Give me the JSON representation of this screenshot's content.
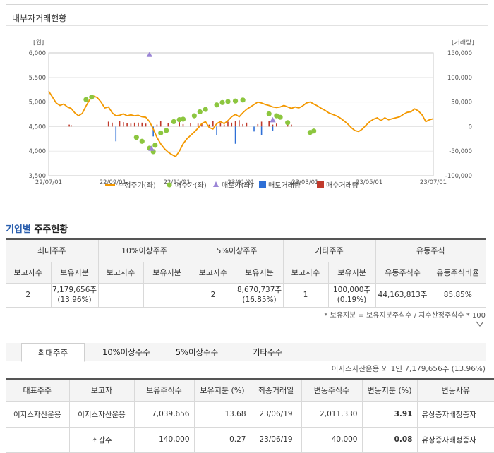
{
  "panel_title": "내부자거래현황",
  "chart_data": {
    "type": "line",
    "title": "",
    "y_left_unit": "[원]",
    "y_right_unit": "[거래량]",
    "y_left_ticks": [
      "6,000",
      "5,500",
      "5,000",
      "4,500",
      "4,000",
      "3,500"
    ],
    "y_right_ticks": [
      "150,000",
      "100,000",
      "50,000",
      "0",
      "-50,000",
      "-100,000"
    ],
    "ylim_left": [
      3500,
      6000
    ],
    "ylim_right": [
      -100000,
      150000
    ],
    "x_ticks": [
      "22/07/01",
      "22/09/01",
      "22/11/01",
      "23/01/01",
      "23/03/01",
      "23/05/01",
      "23/07/01"
    ],
    "legend": [
      "수정주가(좌)",
      "매수가(좌)",
      "매도가(좌)",
      "매도거래량",
      "매수거래량"
    ],
    "colors": {
      "price": "#f39800",
      "buy": "#8cc63f",
      "sell": "#9b85d6",
      "sell_volume": "#2e6fd6",
      "buy_volume": "#c0392b"
    },
    "price_series": [
      [
        0,
        5220
      ],
      [
        2,
        5100
      ],
      [
        4,
        4980
      ],
      [
        6,
        4930
      ],
      [
        8,
        4960
      ],
      [
        10,
        4900
      ],
      [
        12,
        4870
      ],
      [
        14,
        4780
      ],
      [
        16,
        4720
      ],
      [
        18,
        4770
      ],
      [
        20,
        4920
      ],
      [
        22,
        5050
      ],
      [
        24,
        5120
      ],
      [
        26,
        5090
      ],
      [
        28,
        5000
      ],
      [
        30,
        4880
      ],
      [
        32,
        4900
      ],
      [
        34,
        4780
      ],
      [
        36,
        4720
      ],
      [
        38,
        4730
      ],
      [
        40,
        4760
      ],
      [
        42,
        4720
      ],
      [
        44,
        4740
      ],
      [
        46,
        4720
      ],
      [
        48,
        4730
      ],
      [
        50,
        4700
      ],
      [
        52,
        4690
      ],
      [
        54,
        4600
      ],
      [
        56,
        4450
      ],
      [
        58,
        4280
      ],
      [
        60,
        4150
      ],
      [
        62,
        4050
      ],
      [
        64,
        3980
      ],
      [
        66,
        3930
      ],
      [
        68,
        3890
      ],
      [
        70,
        4000
      ],
      [
        72,
        4150
      ],
      [
        74,
        4250
      ],
      [
        76,
        4320
      ],
      [
        78,
        4390
      ],
      [
        80,
        4470
      ],
      [
        82,
        4560
      ],
      [
        84,
        4600
      ],
      [
        86,
        4480
      ],
      [
        88,
        4450
      ],
      [
        90,
        4560
      ],
      [
        92,
        4600
      ],
      [
        94,
        4560
      ],
      [
        96,
        4620
      ],
      [
        98,
        4700
      ],
      [
        100,
        4750
      ],
      [
        102,
        4700
      ],
      [
        104,
        4780
      ],
      [
        106,
        4850
      ],
      [
        108,
        4900
      ],
      [
        110,
        4950
      ],
      [
        112,
        5000
      ],
      [
        114,
        4980
      ],
      [
        116,
        4950
      ],
      [
        118,
        4930
      ],
      [
        120,
        4900
      ],
      [
        122,
        4890
      ],
      [
        124,
        4900
      ],
      [
        126,
        4930
      ],
      [
        128,
        4900
      ],
      [
        130,
        4870
      ],
      [
        132,
        4900
      ],
      [
        134,
        4880
      ],
      [
        136,
        4920
      ],
      [
        138,
        4980
      ],
      [
        140,
        5000
      ],
      [
        142,
        4960
      ],
      [
        144,
        4920
      ],
      [
        146,
        4870
      ],
      [
        148,
        4830
      ],
      [
        150,
        4780
      ],
      [
        152,
        4750
      ],
      [
        154,
        4720
      ],
      [
        156,
        4680
      ],
      [
        158,
        4620
      ],
      [
        160,
        4560
      ],
      [
        162,
        4480
      ],
      [
        164,
        4420
      ],
      [
        166,
        4400
      ],
      [
        168,
        4450
      ],
      [
        170,
        4530
      ],
      [
        172,
        4600
      ],
      [
        174,
        4650
      ],
      [
        176,
        4680
      ],
      [
        178,
        4620
      ],
      [
        180,
        4680
      ],
      [
        182,
        4640
      ],
      [
        184,
        4660
      ],
      [
        186,
        4680
      ],
      [
        188,
        4700
      ],
      [
        190,
        4750
      ],
      [
        192,
        4790
      ],
      [
        194,
        4800
      ],
      [
        196,
        4860
      ],
      [
        198,
        4820
      ],
      [
        200,
        4740
      ],
      [
        202,
        4600
      ],
      [
        204,
        4640
      ],
      [
        206,
        4660
      ]
    ],
    "buy_points": [
      [
        20,
        5050
      ],
      [
        23,
        5100
      ],
      [
        47,
        4280
      ],
      [
        50,
        4200
      ],
      [
        54,
        4060
      ],
      [
        56,
        3990
      ],
      [
        57,
        4120
      ],
      [
        60,
        4370
      ],
      [
        63,
        4420
      ],
      [
        67,
        4600
      ],
      [
        70,
        4640
      ],
      [
        72,
        4650
      ],
      [
        78,
        4720
      ],
      [
        81,
        4800
      ],
      [
        84,
        4850
      ],
      [
        90,
        4940
      ],
      [
        93,
        4990
      ],
      [
        96,
        5010
      ],
      [
        100,
        5020
      ],
      [
        104,
        5040
      ],
      [
        118,
        4760
      ],
      [
        122,
        4720
      ],
      [
        124,
        4690
      ],
      [
        128,
        4580
      ],
      [
        140,
        4380
      ],
      [
        142,
        4410
      ]
    ],
    "sell_points": [
      [
        54,
        5960
      ],
      [
        55,
        4050
      ],
      [
        120,
        4630
      ]
    ],
    "sell_volume": [
      [
        36,
        -30000
      ],
      [
        56,
        -20000
      ],
      [
        90,
        -18000
      ],
      [
        100,
        -35000
      ],
      [
        110,
        -10000
      ],
      [
        114,
        -18000
      ],
      [
        120,
        -8000
      ]
    ],
    "buy_volume": [
      [
        11,
        4000
      ],
      [
        12,
        3000
      ],
      [
        32,
        10000
      ],
      [
        34,
        8000
      ],
      [
        38,
        11000
      ],
      [
        40,
        9000
      ],
      [
        42,
        7000
      ],
      [
        44,
        6000
      ],
      [
        46,
        8000
      ],
      [
        48,
        8000
      ],
      [
        50,
        8000
      ],
      [
        52,
        6000
      ],
      [
        58,
        4000
      ],
      [
        60,
        11000
      ],
      [
        64,
        7000
      ],
      [
        70,
        9000
      ],
      [
        72,
        5000
      ],
      [
        76,
        7000
      ],
      [
        80,
        6000
      ],
      [
        82,
        6000
      ],
      [
        86,
        4000
      ],
      [
        88,
        12000
      ],
      [
        92,
        8000
      ],
      [
        94,
        4000
      ],
      [
        96,
        10000
      ],
      [
        98,
        8000
      ],
      [
        100,
        11000
      ],
      [
        102,
        13000
      ],
      [
        104,
        5000
      ],
      [
        106,
        8000
      ],
      [
        112,
        5000
      ],
      [
        114,
        10000
      ],
      [
        118,
        11000
      ],
      [
        120,
        4000
      ],
      [
        122,
        6000
      ],
      [
        128,
        4000
      ],
      [
        130,
        4000
      ]
    ]
  },
  "section_title_accent": "기업별",
  "section_title_rest": " 주주현황",
  "holders_table": {
    "groups": [
      "최대주주",
      "10%이상주주",
      "5%이상주주",
      "기타주주",
      "유동주식"
    ],
    "subheaders": [
      "보고자수",
      "보유지분",
      "보고자수",
      "보유지분",
      "보고자수",
      "보유지분",
      "보고자수",
      "보유지분",
      "유동주식수",
      "유동주식비율"
    ],
    "row": {
      "max_count": "2",
      "max_share_1": "7,179,656주",
      "max_share_2": "(13.96%)",
      "ten_count": "",
      "ten_share": "",
      "five_count": "2",
      "five_share_1": "8,670,737주",
      "five_share_2": "(16.85%)",
      "etc_count": "1",
      "etc_share_1": "100,000주",
      "etc_share_2": "(0.19%)",
      "float_count": "44,163,813주",
      "float_ratio": "85.85%"
    }
  },
  "note": "* 보유지분 = 보유지분주식수 / 지수산정주식수 * 100",
  "tabs": [
    "최대주주",
    "10%이상주주",
    "5%이상주주",
    "기타주주"
  ],
  "summary": "이지스자산운용 외 1인 7,179,656주 (13.96%)",
  "detail_table": {
    "headers": [
      "대표주주",
      "보고자",
      "보유주식수",
      "보유지분 (%)",
      "최종거래일",
      "변동주식수",
      "변동지분 (%)",
      "변동사유"
    ],
    "rows": [
      [
        "이지스자산운용",
        "이지스자산운용",
        "7,039,656",
        "13.68",
        "23/06/19",
        "2,011,330",
        "3.91",
        "유상증자배정증자"
      ],
      [
        "",
        "조갑주",
        "140,000",
        "0.27",
        "23/06/19",
        "40,000",
        "0.08",
        "유상증자배정증자"
      ]
    ]
  }
}
